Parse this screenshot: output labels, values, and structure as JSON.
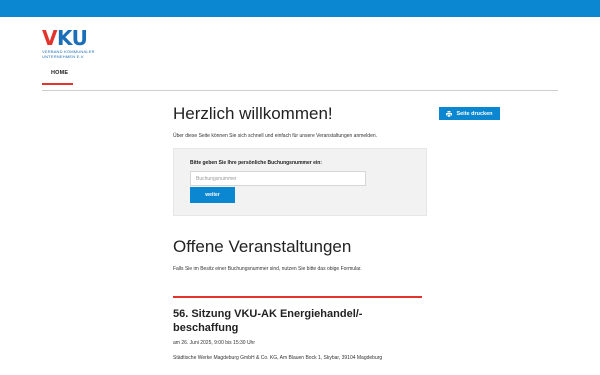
{
  "colors": {
    "brand_blue": "#0a87d0",
    "brand_red": "#e2342c",
    "logo_blue": "#1a6fb8",
    "panel_bg": "#f2f2f2"
  },
  "logo": {
    "mark_v": "V",
    "mark_ku": "KU",
    "subline_1": "VERBAND KOMMUNALER",
    "subline_2": "UNTERNEHMEN e.V."
  },
  "nav": {
    "home_label": "HOME"
  },
  "toolbar": {
    "print_label": "Seite drucken",
    "print_icon": "printer-icon"
  },
  "welcome": {
    "title": "Herzlich willkommen!",
    "intro": "Über diese Seite können Sie sich schnell und einfach für unsere Veranstaltungen anmelden."
  },
  "booking_form": {
    "label": "Bitte geben Sie Ihre persönliche Buchungsnummer ein:",
    "placeholder": "Buchungsnummer",
    "value": "",
    "submit_label": "weiter"
  },
  "events_section": {
    "title": "Offene Veranstaltungen",
    "note": "Falls Sie im Besitz einer Buchungsnummer sind, nutzen Sie bitte das obige Formular."
  },
  "events": [
    {
      "title": "56. Sitzung VKU-AK Energiehandel/-beschaffung",
      "date": "am 26. Juni 2025, 9:00 bis 15:30 Uhr",
      "location": "Städtische Werke Magdeburg GmbH & Co. KG, Am Blauen Bock 1, Skybar, 39104 Magdeburg"
    }
  ]
}
